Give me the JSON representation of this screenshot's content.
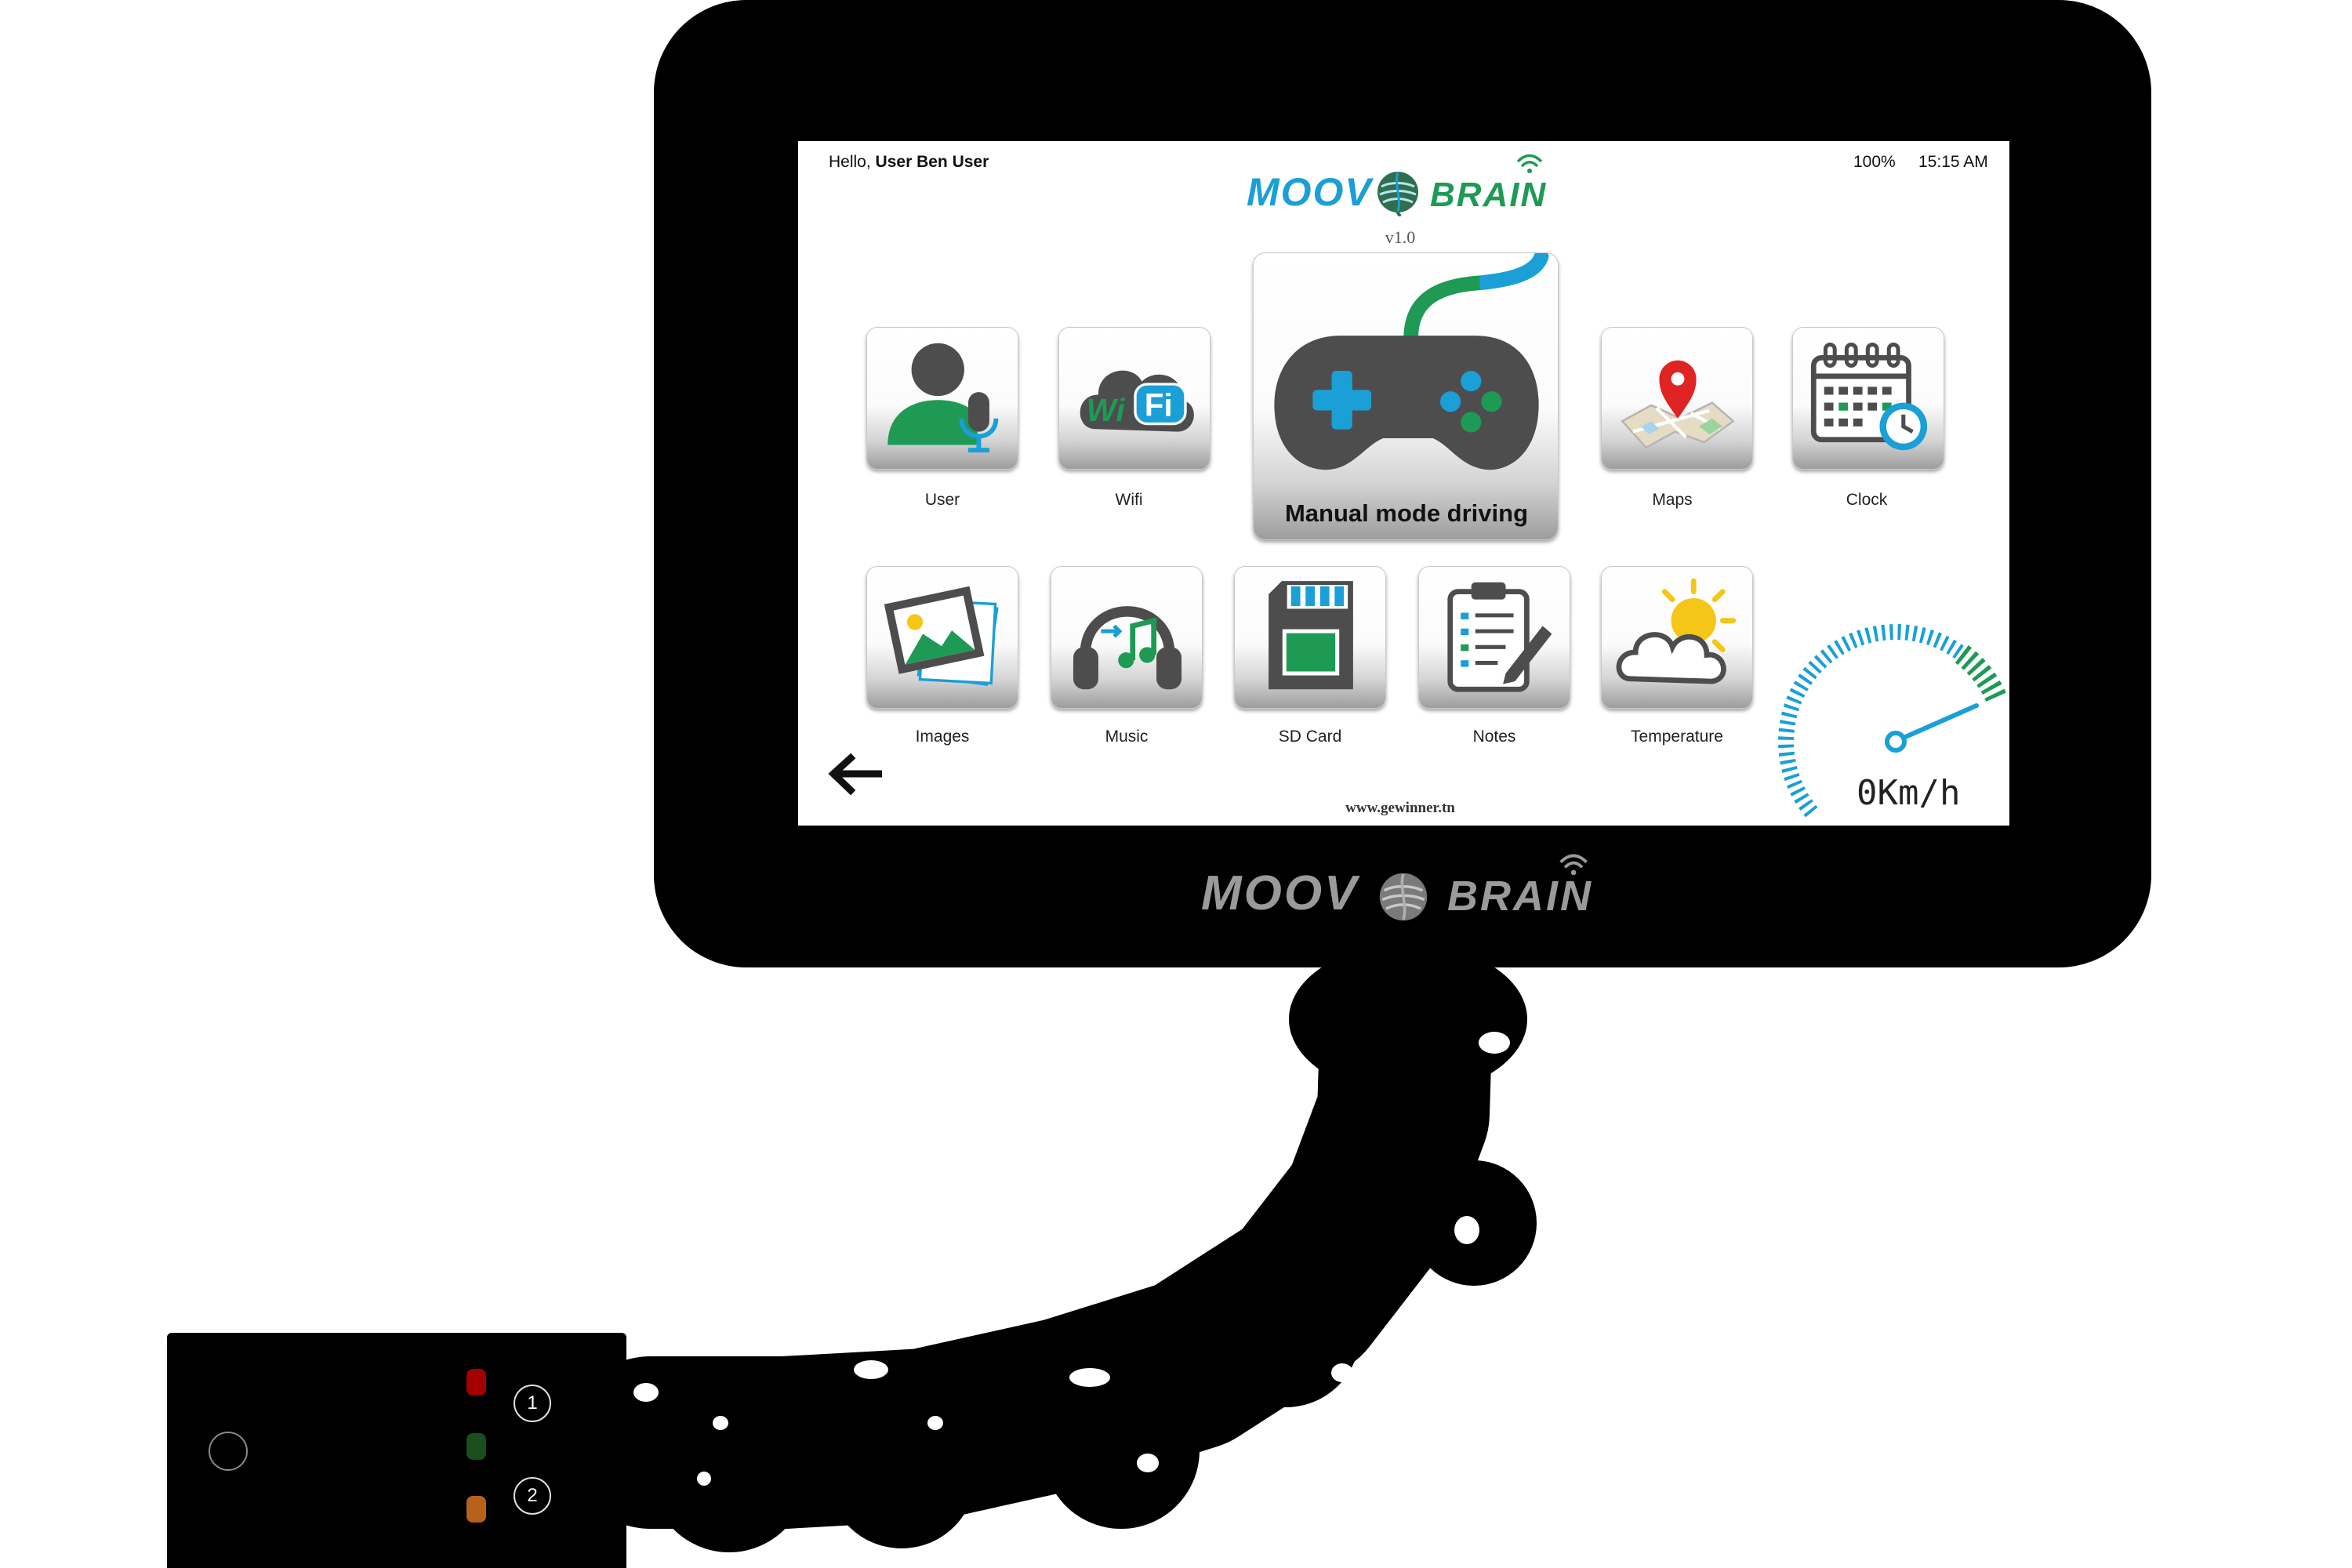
{
  "screen": {
    "greeting_prefix": "Hello,",
    "greeting_name": "User Ben User",
    "battery": "100%",
    "time": "15:15 AM",
    "logo": {
      "left": "MOOV",
      "right": "BRAIN",
      "icon": "brain-icon"
    },
    "version": "v1.0",
    "apps": [
      {
        "label": "User",
        "icon": "user-microphone-icon"
      },
      {
        "label": "Wifi",
        "icon": "wifi-icon",
        "icon_text": [
          "Wi",
          "Fi"
        ]
      },
      {
        "label": "Maps",
        "icon": "map-pin-icon"
      },
      {
        "label": "Clock",
        "icon": "calendar-clock-icon"
      },
      {
        "label": "Images",
        "icon": "images-icon"
      },
      {
        "label": "Music",
        "icon": "headphones-music-icon"
      },
      {
        "label": "SD Card",
        "icon": "sd-card-icon"
      },
      {
        "label": "Notes",
        "icon": "clipboard-notes-icon"
      },
      {
        "label": "Temperature",
        "icon": "sun-cloud-icon"
      }
    ],
    "featured_app": {
      "label": "Manual mode driving",
      "icon": "gamepad-icon"
    },
    "back_icon": "arrow-left-icon",
    "website": "www.gewinner.tn",
    "speedometer": {
      "icon": "speedometer-gauge-icon",
      "speed": "0Km/h"
    }
  },
  "bezel_logo": {
    "left": "MOOV",
    "right": "BRAIN"
  },
  "control_box": {
    "power_icon": "circle-button-icon",
    "leds": [
      {
        "color": "#a30000"
      },
      {
        "color": "#1c4d1c"
      },
      {
        "color": "#b8611a"
      }
    ],
    "buttons": [
      "1",
      "2"
    ]
  },
  "colors": {
    "accent_blue": "#1a9fd6",
    "accent_green": "#1e9a55",
    "icon_dark": "#4d4d4d",
    "bezel": "#000000"
  }
}
